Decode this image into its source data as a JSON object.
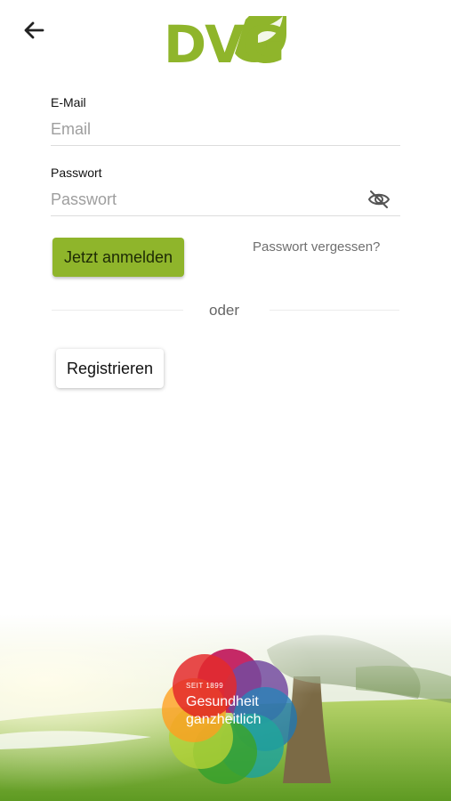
{
  "header": {
    "back_icon": "arrow-left-icon",
    "logo_text": "DVG",
    "colors": {
      "brand_green": "#8fb52b"
    }
  },
  "form": {
    "email_label": "E-Mail",
    "email_placeholder": "Email",
    "email_value": "",
    "password_label": "Passwort",
    "password_placeholder": "Passwort",
    "password_value": "",
    "password_visibility_icon": "eye-slash-icon",
    "login_button": "Jetzt anmelden",
    "forgot_link": "Passwort vergessen?",
    "divider_text": "oder",
    "register_button": "Registrieren"
  },
  "footer": {
    "badge_small": "SEIT 1899",
    "badge_line1": "Gesundheit",
    "badge_line2": "ganzheitlich",
    "badge_icon": "flower-badge-icon"
  }
}
